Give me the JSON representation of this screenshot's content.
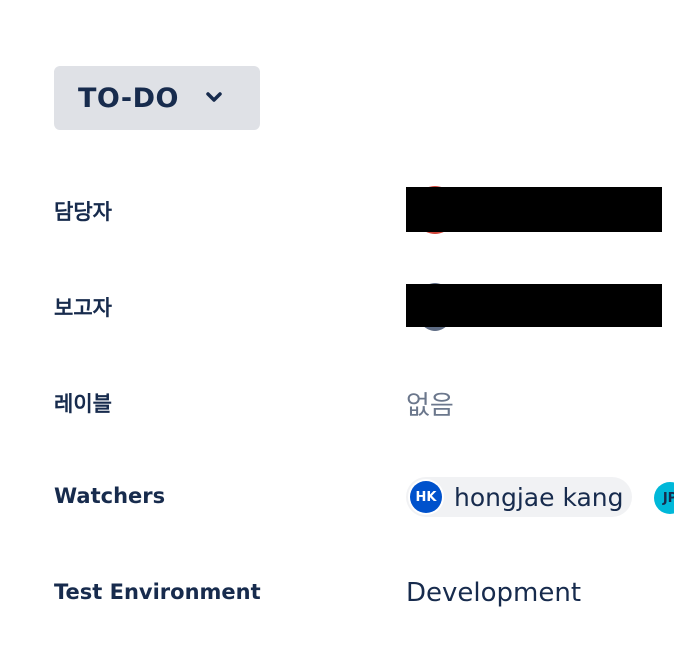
{
  "status": {
    "label": "TO-DO",
    "chevron_icon": "chevron-down-icon"
  },
  "fields": {
    "assignee": {
      "label": "담당자"
    },
    "reporter": {
      "label": "보고자"
    },
    "labels": {
      "label": "레이블",
      "value": "없음"
    },
    "watchers": {
      "label": "Watchers",
      "people": [
        {
          "initials": "HK",
          "name": "hongjae kang",
          "color": "#0052CC"
        },
        {
          "initials": "JP",
          "color": "#00B8D9"
        }
      ]
    },
    "test_environment": {
      "label": "Test Environment",
      "value": "Development"
    }
  },
  "colors": {
    "text": "#172B4D",
    "muted": "#6B778C",
    "status_bg": "#DFE1E6",
    "chip_bg": "#F1F2F4"
  }
}
